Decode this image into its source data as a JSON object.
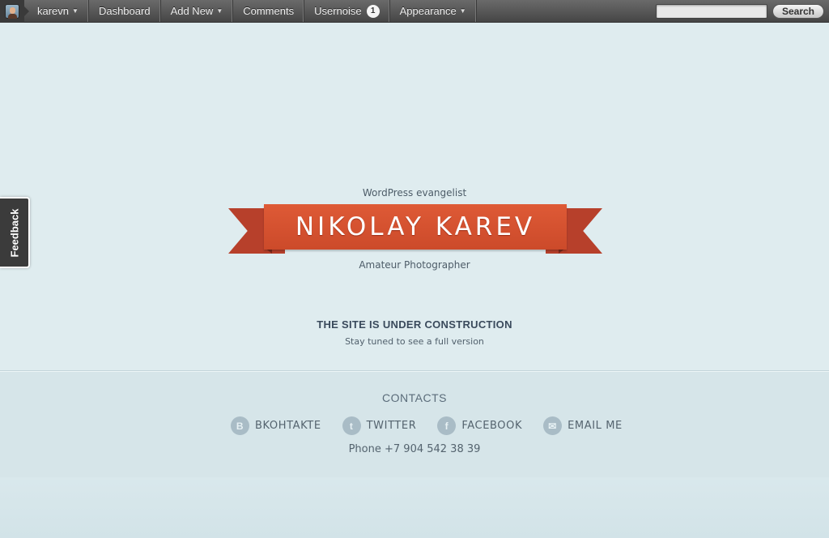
{
  "adminbar": {
    "user": "karevn",
    "items": [
      {
        "label": "Dashboard"
      },
      {
        "label": "Add New"
      },
      {
        "label": "Comments"
      },
      {
        "label": "Usernoise",
        "count": "1"
      },
      {
        "label": "Appearance"
      }
    ],
    "search_button": "Search",
    "search_value": ""
  },
  "feedback_tab": "Feedback",
  "hero": {
    "tagline": "WordPress evangelist",
    "name": "NIKOLAY KAREV",
    "subtag": "Amateur Photographer"
  },
  "construction": {
    "title": "THE SITE IS UNDER CONSTRUCTION",
    "subtitle": "Stay tuned to see a full version"
  },
  "contacts": {
    "title": "CONTACTS",
    "links": [
      {
        "label": "BKOHTAKTE",
        "icon": "vk-icon",
        "glyph": "B"
      },
      {
        "label": "TWITTER",
        "icon": "twitter-icon",
        "glyph": "t"
      },
      {
        "label": "FACEBOOK",
        "icon": "facebook-icon",
        "glyph": "f"
      },
      {
        "label": "EMAIL ME",
        "icon": "email-icon",
        "glyph": "✉"
      }
    ],
    "phone": "Phone +7 904 542 38 39"
  },
  "colors": {
    "background": "#dfecef",
    "ribbon": "#d6512f",
    "adminbar": "#555555"
  }
}
